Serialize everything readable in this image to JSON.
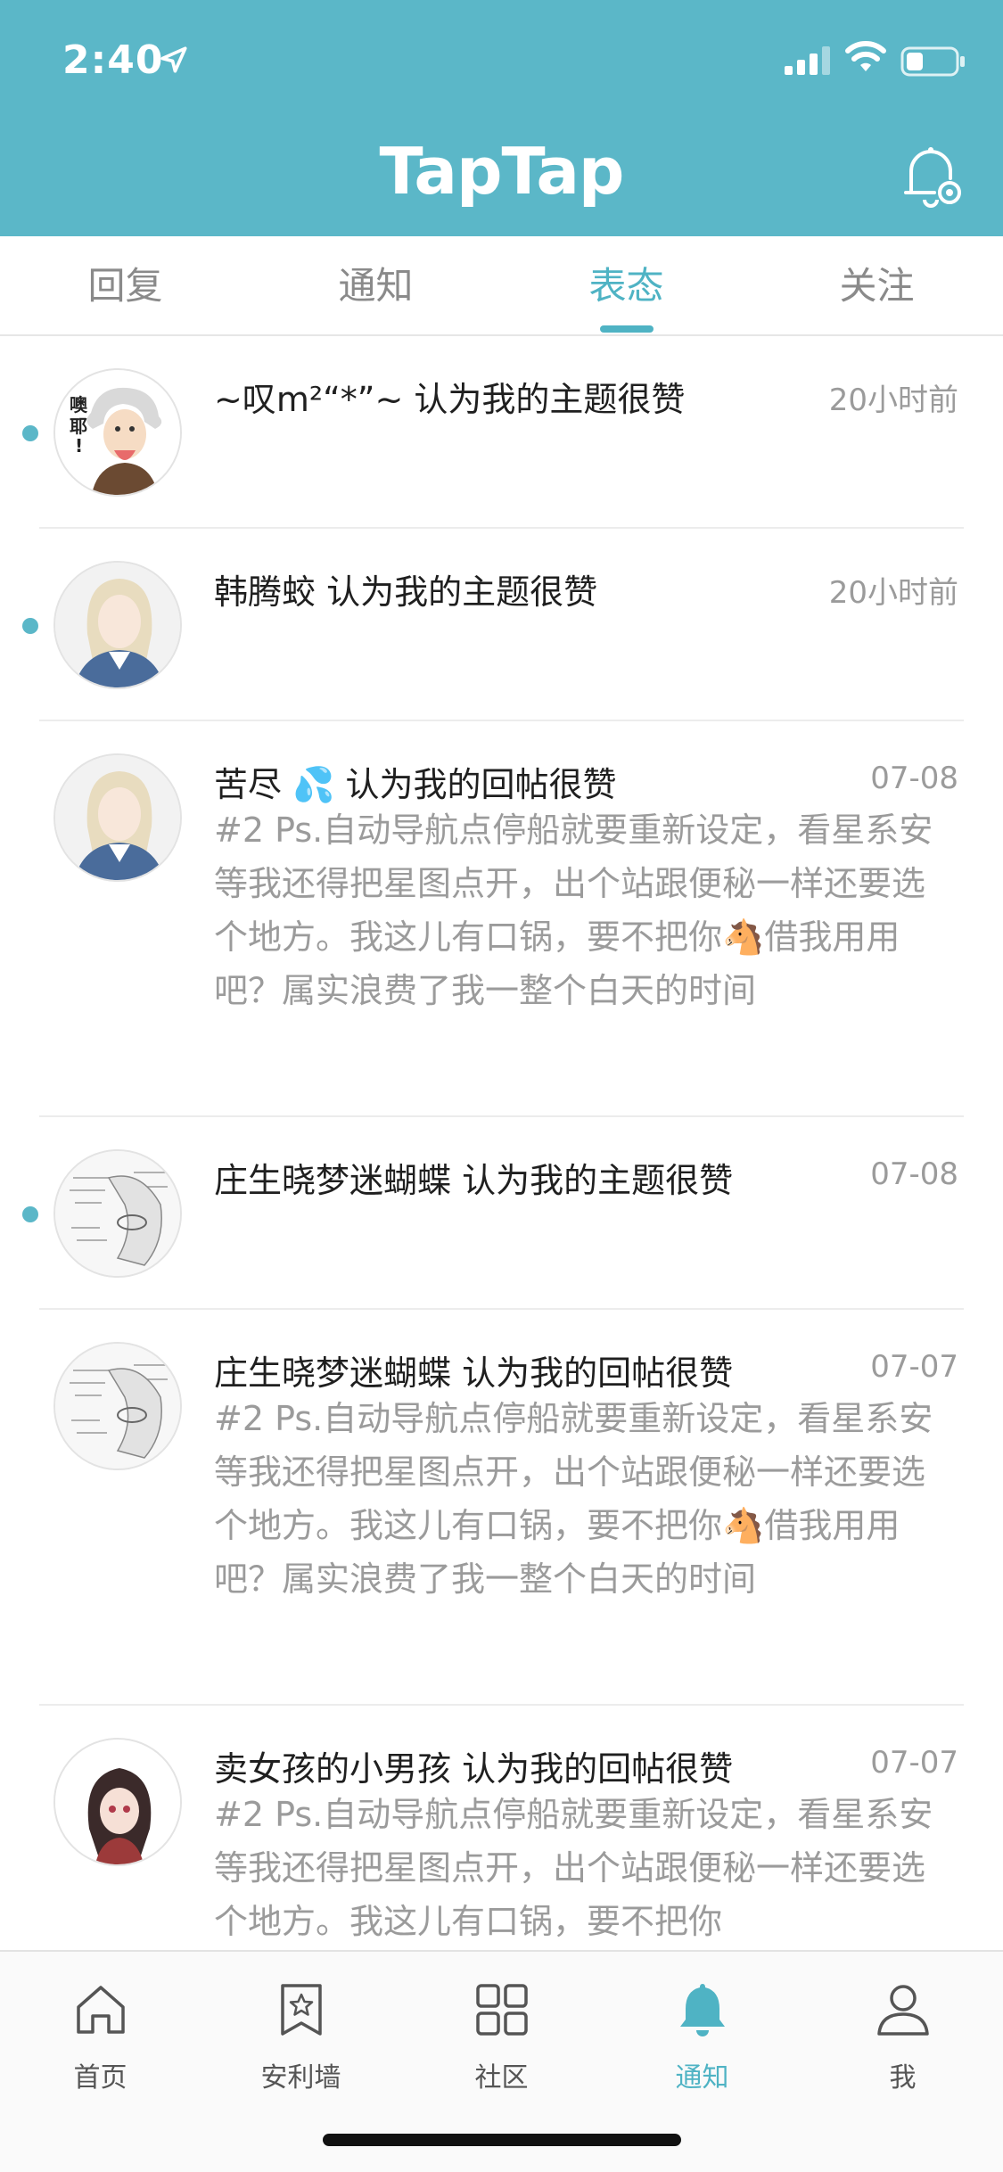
{
  "status_bar": {
    "time": "2:40"
  },
  "header": {
    "logo": "TapTap"
  },
  "tabs": [
    {
      "label": "回复"
    },
    {
      "label": "通知"
    },
    {
      "label": "表态",
      "active": true
    },
    {
      "label": "关注"
    }
  ],
  "notifications": [
    {
      "title": "~叹m²“*”~ 认为我的主题很赞",
      "time": "20小时前",
      "unread": true,
      "body": ""
    },
    {
      "title": "韩腾蛟 认为我的主题很赞",
      "time": "20小时前",
      "unread": true,
      "body": ""
    },
    {
      "title": "苦尽 💦 认为我的回帖很赞",
      "time": "07-08",
      "unread": false,
      "body": "#2 Ps.自动导航点停船就要重新设定，看星系安等我还得把星图点开，出个站跟便秘一样还要选个地方。我这儿有口锅，要不把你🐴借我用用吧？属实浪费了我一整个白天的时间"
    },
    {
      "title": "庄生晓梦迷蝴蝶 认为我的主题很赞",
      "time": "07-08",
      "unread": true,
      "body": ""
    },
    {
      "title": "庄生晓梦迷蝴蝶 认为我的回帖很赞",
      "time": "07-07",
      "unread": false,
      "body": "#2 Ps.自动导航点停船就要重新设定，看星系安等我还得把星图点开，出个站跟便秘一样还要选个地方。我这儿有口锅，要不把你🐴借我用用吧？属实浪费了我一整个白天的时间"
    },
    {
      "title": "卖女孩的小男孩 认为我的回帖很赞",
      "time": "07-07",
      "unread": false,
      "body": "#2 Ps.自动导航点停船就要重新设定，看星系安等我还得把星图点开，出个站跟便秘一样还要选个地方。我这儿有口锅，要不把你"
    }
  ],
  "bottom_nav": [
    {
      "label": "首页",
      "icon": "home-icon"
    },
    {
      "label": "安利墙",
      "icon": "bookmark-star-icon"
    },
    {
      "label": "社区",
      "icon": "grid-icon"
    },
    {
      "label": "通知",
      "icon": "bell-icon",
      "active": true
    },
    {
      "label": "我",
      "icon": "user-icon"
    }
  ],
  "colors": {
    "accent": "#5bb7c8",
    "active_text": "#4fb3c4",
    "muted": "#9b9b9b"
  }
}
